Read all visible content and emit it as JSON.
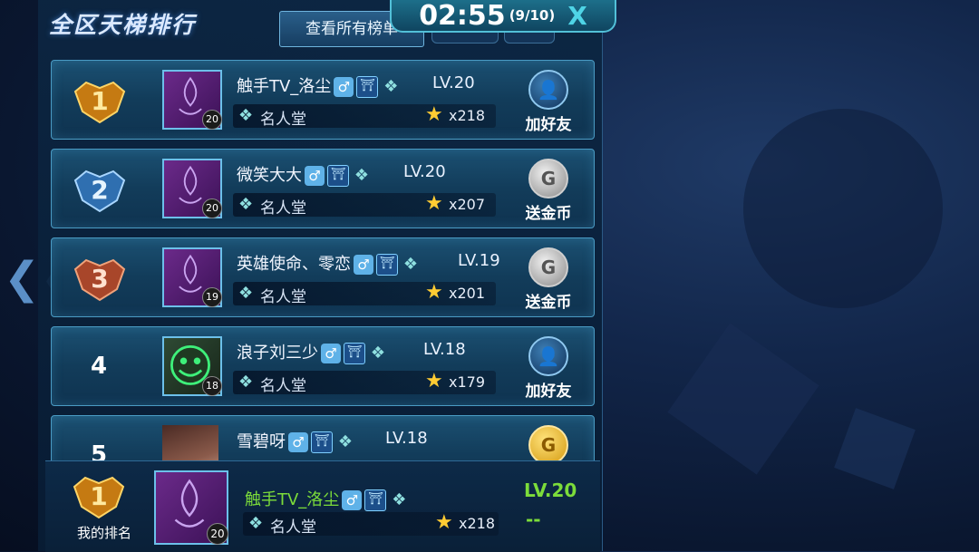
{
  "header": {
    "title": "全区天梯排行",
    "view_all_label": "查看所有榜单",
    "timer": "02:55",
    "timer_count": "(9/10)",
    "close_glyph": "X"
  },
  "rows": [
    {
      "rank": "1",
      "name": "触手TV_洛尘",
      "gender": "♂",
      "level": "LV.20",
      "avatar_level": "20",
      "title": "名人堂",
      "stars": "x218",
      "action": "加好友",
      "action_icon": "add-friend-icon"
    },
    {
      "rank": "2",
      "name": "微笑大大",
      "gender": "♂",
      "level": "LV.20",
      "avatar_level": "20",
      "title": "名人堂",
      "stars": "x207",
      "action": "送金币",
      "action_icon": "coin-icon"
    },
    {
      "rank": "3",
      "name": "英雄使命、零恋",
      "gender": "♂",
      "level": "LV.19",
      "avatar_level": "19",
      "title": "名人堂",
      "stars": "x201",
      "action": "送金币",
      "action_icon": "coin-icon"
    },
    {
      "rank": "4",
      "name": "浪子刘三少",
      "gender": "♂",
      "level": "LV.18",
      "avatar_level": "18",
      "title": "名人堂",
      "stars": "x179",
      "action": "加好友",
      "action_icon": "add-friend-icon"
    },
    {
      "rank": "5",
      "name": "雪碧呀",
      "gender": "♂",
      "level": "LV.18",
      "avatar_level": "",
      "title": "",
      "stars": "",
      "action": "",
      "action_icon": "gold-coin-icon"
    }
  ],
  "my_rank": {
    "label": "我的排名",
    "rank": "1",
    "name": "触手TV_洛尘",
    "gender": "♂",
    "avatar_level": "20",
    "title": "名人堂",
    "stars": "x218",
    "level": "LV.20",
    "dash": "--"
  },
  "colors": {
    "accent_green": "#7cdc3a",
    "panel_border": "#4a9bc4",
    "star_gold": "#ffcc33"
  }
}
